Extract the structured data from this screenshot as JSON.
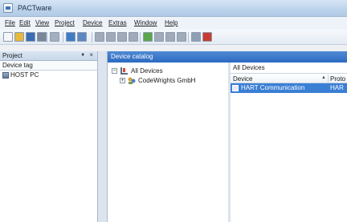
{
  "window": {
    "title": "PACTware"
  },
  "menu": [
    "File",
    "Edit",
    "View",
    "Project",
    "Device",
    "Extras",
    "Window",
    "Help"
  ],
  "toolbar": {
    "buttons": [
      {
        "icon": "new-icon",
        "color": "#f5f7fa"
      },
      {
        "icon": "open-icon",
        "color": "#e5b83f"
      },
      {
        "icon": "save-icon",
        "color": "#3c6db3"
      },
      {
        "icon": "print-icon",
        "color": "#7a8796"
      },
      {
        "icon": "print-preview-icon",
        "color": "#a3b0bf"
      },
      {
        "icon": "device-catalog-icon",
        "color": "#3e7cc7"
      },
      {
        "icon": "project-icon",
        "color": "#5c88c2"
      },
      {
        "icon": "connect-icon",
        "color": "#a0aab8"
      },
      {
        "icon": "disconnect-icon",
        "color": "#a0aab8"
      },
      {
        "icon": "load-icon",
        "color": "#a0aab8"
      },
      {
        "icon": "store-icon",
        "color": "#a0aab8"
      },
      {
        "icon": "add-device-icon",
        "color": "#5ca64c"
      },
      {
        "icon": "parameter-icon",
        "color": "#a0aab8"
      },
      {
        "icon": "measured-value-icon",
        "color": "#a0aab8"
      },
      {
        "icon": "simulation-icon",
        "color": "#a0aab8"
      },
      {
        "icon": "diagnosis-icon",
        "color": "#8fa0b4"
      },
      {
        "icon": "stop-icon",
        "color": "#c93b32"
      }
    ]
  },
  "project_panel": {
    "title": "Project",
    "pin": "♦",
    "close": "×",
    "column": "Device tag",
    "rows": [
      "HOST PC"
    ]
  },
  "catalog": {
    "tab": "Device catalog",
    "tree": {
      "root": "All Devices",
      "children": [
        "CodeWrights GmbH"
      ],
      "expander_root": "−",
      "expander_child": "+"
    },
    "list": {
      "title": "All Devices",
      "columns": [
        "Device",
        "Proto"
      ],
      "rows": [
        {
          "device": "HART Communication",
          "protocol": "HAR",
          "selected": true
        }
      ]
    }
  },
  "colors": {
    "accent": "#2c6ac1",
    "selection": "#3a7fd4"
  }
}
